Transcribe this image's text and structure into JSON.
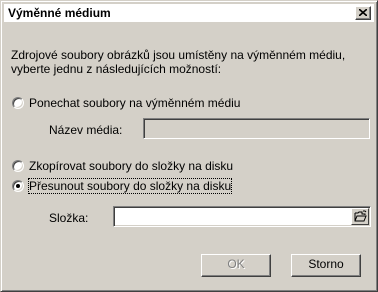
{
  "window": {
    "title": "Výměnné médium"
  },
  "description": {
    "line1": "Zdrojové soubory obrázků jsou umístěny na výměnném médiu,",
    "line2": "vyberte jednu z následujících možností:"
  },
  "options": {
    "keep": {
      "label": "Ponechat soubory na výměnném médiu",
      "checked": false
    },
    "media_name": {
      "label": "Název média:",
      "value": "",
      "enabled": false
    },
    "copy": {
      "label": "Zkopírovat soubory do složky na disku",
      "checked": false
    },
    "move": {
      "label": "Přesunout soubory do složky na disku",
      "checked": true
    },
    "folder": {
      "label": "Složka:",
      "value": "",
      "enabled": true
    }
  },
  "buttons": {
    "ok": {
      "label": "OK",
      "enabled": false
    },
    "cancel": {
      "label": "Storno",
      "enabled": true
    }
  },
  "icons": {
    "close": "close-icon",
    "browse": "folder-open-icon"
  }
}
